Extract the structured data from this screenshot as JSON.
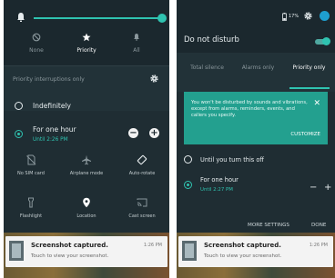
{
  "left": {
    "modes": [
      {
        "label": "None",
        "icon": "block-icon",
        "active": false
      },
      {
        "label": "Priority",
        "icon": "star-icon",
        "active": true
      },
      {
        "label": "All",
        "icon": "all-icon",
        "active": false
      }
    ],
    "section_title": "Priority interruptions only",
    "option_indefinitely": "Indefinitely",
    "option_hour": "For one hour",
    "option_hour_until": "Until 2:26 PM",
    "tiles_row1": [
      "No SIM card",
      "Airplane mode",
      "Auto-rotate"
    ],
    "tiles_row2": [
      "Flashlight",
      "Location",
      "Cast screen"
    ],
    "notification": {
      "title": "Screenshot captured.",
      "subtitle": "Touch to view your screenshot.",
      "time": "1:26 PM"
    }
  },
  "right": {
    "status": {
      "battery": "17%"
    },
    "title": "Do not disturb",
    "tabs": [
      {
        "label": "Total silence",
        "active": false
      },
      {
        "label": "Alarms only",
        "active": false
      },
      {
        "label": "Priority only",
        "active": true
      }
    ],
    "banner": {
      "message": "You won't be disturbed by sounds and vibrations, except from alarms, reminders, events, and callers you specify.",
      "close": "✕",
      "action": "CUSTOMIZE"
    },
    "option_off": "Until you turn this off",
    "option_hour": "For one hour",
    "option_hour_until": "Until 2:27 PM",
    "more_settings": "MORE SETTINGS",
    "done": "DONE",
    "notification": {
      "title": "Screenshot captured.",
      "subtitle": "Touch to view your screenshot.",
      "time": "1:26 PM"
    }
  },
  "colors": {
    "accent": "#2fc3b0",
    "background": "#1f2d33",
    "banner": "#23a08f"
  }
}
